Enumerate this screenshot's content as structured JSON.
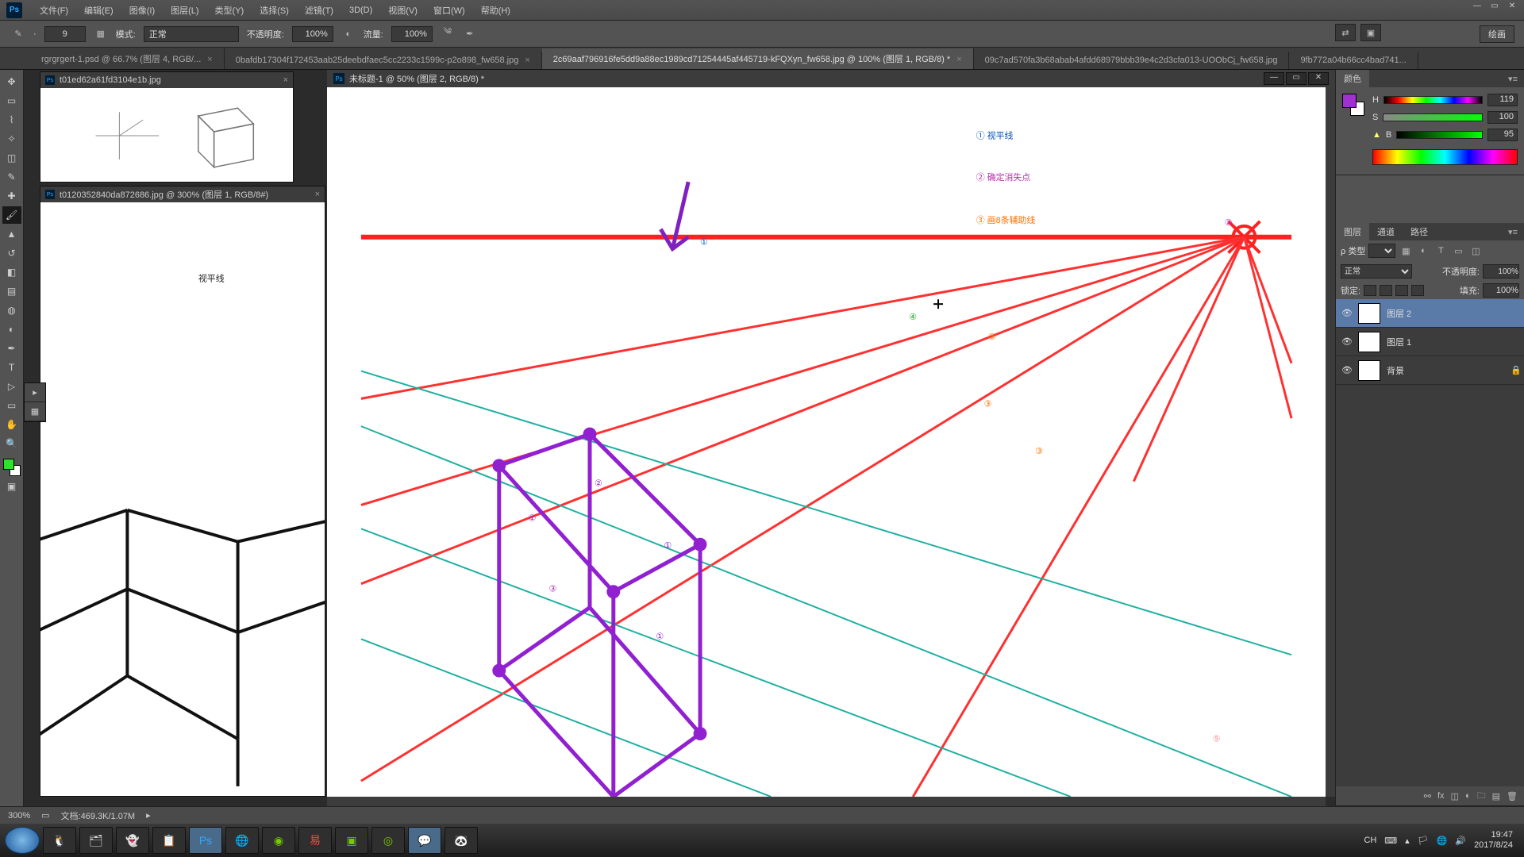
{
  "menu": {
    "items": [
      "文件(F)",
      "编辑(E)",
      "图像(I)",
      "图层(L)",
      "类型(Y)",
      "选择(S)",
      "滤镜(T)",
      "3D(D)",
      "视图(V)",
      "窗口(W)",
      "帮助(H)"
    ]
  },
  "optionbar": {
    "brush_size": "9",
    "mode_label": "模式:",
    "mode_value": "正常",
    "opacity_label": "不透明度:",
    "opacity_value": "100%",
    "flow_label": "流量:",
    "flow_value": "100%",
    "right_label": "绘画"
  },
  "doctabs": [
    {
      "label": "rgrgrgert-1.psd @ 66.7% (图层 4, RGB/...",
      "active": false
    },
    {
      "label": "0bafdb17304f172453aab25deebdfaec5cc2233c1599c-p2o898_fw658.jpg",
      "active": false
    },
    {
      "label": "2c69aaf796916fe5dd9a88ec1989cd71254445af445719-kFQXyn_fw658.jpg @ 100% (图层 1, RGB/8) *",
      "active": true
    },
    {
      "label": "09c7ad570fa3b68abab4afdd68979bbb39e4c2d3cfa013-UOObCj_fw658.jpg",
      "active": false
    },
    {
      "label": "9fb772a04b66cc4bad741...",
      "active": false
    }
  ],
  "float1": {
    "title": "t01ed62a61fd3104e1b.jpg"
  },
  "float2": {
    "title": "t0120352840da872686.jpg @ 300% (图层 1, RGB/8#)"
  },
  "float2_text": "视平线",
  "canvas_doc": {
    "title": "未标题-1 @ 50% (图层 2, RGB/8) *"
  },
  "annotations": {
    "a1": "① 视平线",
    "a2": "② 确定消失点",
    "a3": "③ 画8条辅助线",
    "h1": "①",
    "h2": "②",
    "h3a": "③",
    "h3b": "③",
    "h3c": "③",
    "h4": "④",
    "c1": "①",
    "c1b": "①",
    "c1c": "①",
    "c2": "②",
    "c3": "③",
    "c5": "⑤"
  },
  "color_panel": {
    "tab": "颜色",
    "H": "H",
    "H_val": "119",
    "S": "S",
    "S_val": "100",
    "B": "B",
    "B_val": "95"
  },
  "layers_panel": {
    "tabs": [
      "图层",
      "通道",
      "路径"
    ],
    "kind_label": "ρ 类型",
    "blend": "正常",
    "opacity_label": "不透明度:",
    "opacity_val": "100%",
    "lock_label": "锁定:",
    "fill_label": "填充:",
    "fill_val": "100%",
    "layers": [
      {
        "name": "图层 2",
        "selected": true,
        "locked": false
      },
      {
        "name": "图层 1",
        "selected": false,
        "locked": false
      },
      {
        "name": "背景",
        "selected": false,
        "locked": true
      }
    ]
  },
  "statusbar": {
    "zoom": "300%",
    "doc": "文档:469.3K/1.07M"
  },
  "taskbar": {
    "lang": "CH",
    "time": "19:47",
    "date": "2017/8/24"
  }
}
